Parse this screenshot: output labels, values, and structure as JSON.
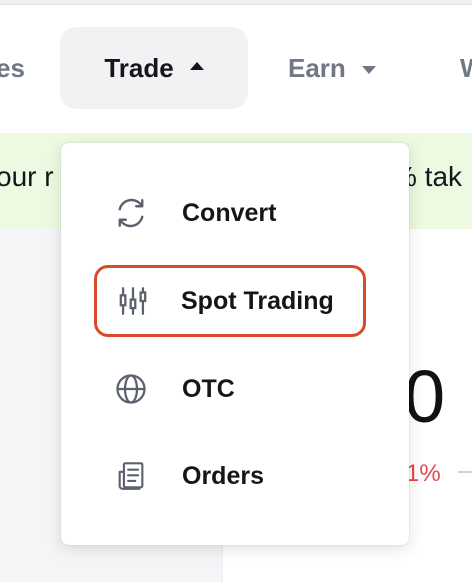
{
  "nav": {
    "prev_label": "es",
    "trade_label": "Trade",
    "earn_label": "Earn",
    "next_label": "W"
  },
  "banner": {
    "left_text": "our r",
    "right_text": "% tak"
  },
  "panel": {
    "big_value": "0",
    "percent": "1%"
  },
  "dropdown": {
    "items": [
      {
        "label": "Convert",
        "icon": "convert-icon"
      },
      {
        "label": "Spot Trading",
        "icon": "candlestick-icon"
      },
      {
        "label": "OTC",
        "icon": "globe-icon"
      },
      {
        "label": "Orders",
        "icon": "orders-icon"
      }
    ],
    "highlight_color": "#d94a2b"
  }
}
